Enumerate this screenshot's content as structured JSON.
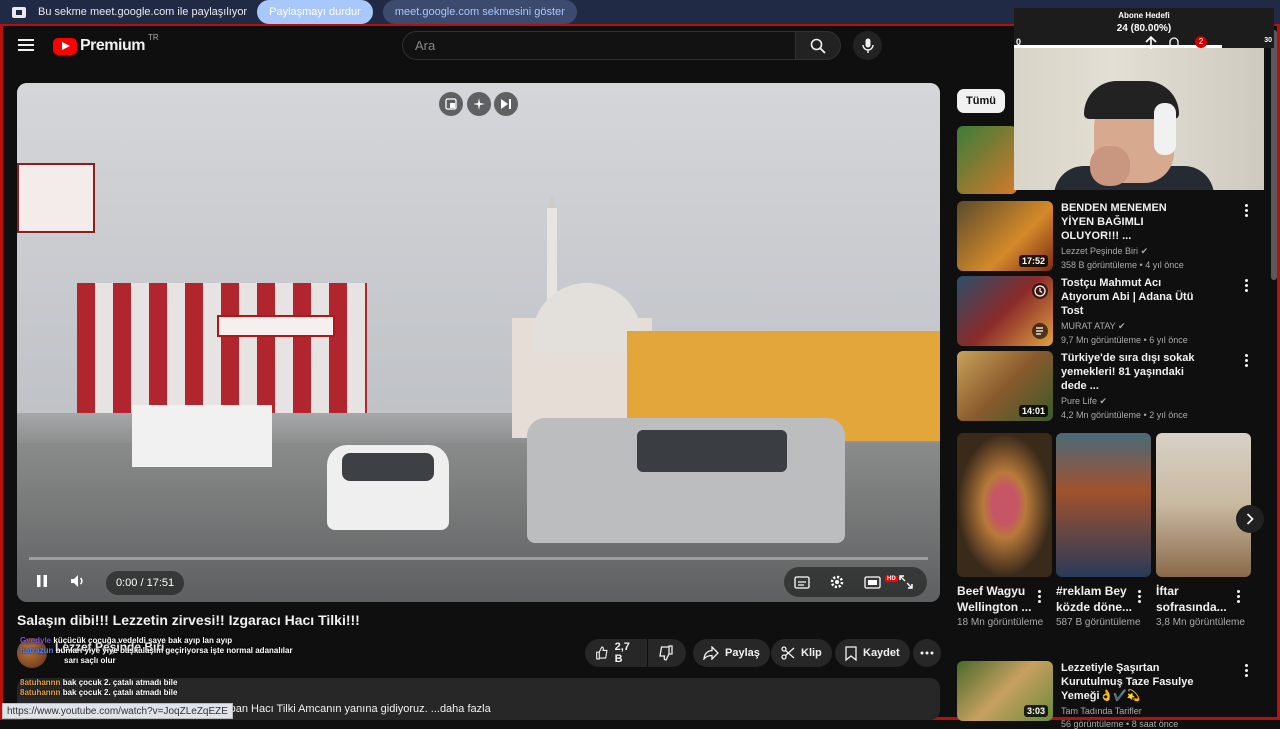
{
  "share_bar": {
    "message": "Bu sekme meet.google.com ile paylaşılıyor",
    "stop_label": "Paylaşmayı durdur",
    "show_label": "meet.google.com sekmesini göster"
  },
  "header": {
    "logo_text": "Premium",
    "region": "TR",
    "search_placeholder": "Ara"
  },
  "player": {
    "time": "0:00 / 17:51",
    "progress_fraction": 0,
    "hd_badge": "HD"
  },
  "video": {
    "title": "Salaşın dibi!!! Lezzetin zirvesi!! Izgaracı Hacı Tilki!!!",
    "channel": "Lezzet Peşinde Biri",
    "like_count": "2,7 B",
    "share_label": "Paylaş",
    "clip_label": "Klip",
    "save_label": "Kaydet",
    "description": "vapan Hacı Tilki Amcanın yanına gidiyoruz. ...daha fazla"
  },
  "chat_overlay": [
    {
      "user": "Gyedyle",
      "text": "küçücük çocuğa vedeldi saye bak ayıp lan ayıp"
    },
    {
      "user": "hatrazun",
      "text": "bunları yiye yiye başkalaşım geçiriyorsa işte normal adanalılar"
    },
    {
      "user": "",
      "text": "sarı saçlı olur"
    },
    {
      "user": "8atuhannn",
      "text": "bak çocuk 2. çatalı atmadı bile"
    },
    {
      "user": "8atuhannn",
      "text": "bak çocuk 2. çatalı atmadı bile"
    }
  ],
  "url_status": "https://www.youtube.com/watch?v=JoqZLeZqEZE",
  "sidebar": {
    "chip_all": "Tümü",
    "recommendations": [
      {
        "title": "BENDEN MENEMEN YİYEN BAĞIMLI OLUYOR!!! ...",
        "channel": "Lezzet Peşinde Biri",
        "meta": "358 B görüntüleme • 4 yıl önce",
        "duration": "17:52",
        "verified": true
      },
      {
        "title": "Tostçu Mahmut Acı Atıyorum Abi | Adana Ütü Tost",
        "channel": "MURAT ATAY",
        "meta": "9,7 Mn görüntüleme • 6 yıl önce",
        "duration": "",
        "verified": true
      },
      {
        "title": "Türkiye'de sıra dışı sokak yemekleri! 81 yaşındaki dede ...",
        "channel": "Pure Life",
        "meta": "4,2 Mn görüntüleme • 2 yıl önce",
        "duration": "14:01",
        "verified": true
      }
    ],
    "shorts": [
      {
        "title": "Beef Wagyu Wellington ...",
        "views": "18 Mn görüntüleme"
      },
      {
        "title": "#reklam Bey közde döne...",
        "views": "587 B görüntüleme"
      },
      {
        "title": "İftar sofrasında...",
        "views": "3,8 Mn görüntüleme"
      }
    ],
    "bottom_rec": {
      "title": "Lezzetiyle Şaşırtan Kurutulmuş Taze Fasulye Yemeği👌✔️💫",
      "channel": "Tam Tadında Tarifler",
      "meta": "56 görüntüleme • 8 saat önce",
      "duration": "3:03"
    }
  },
  "stream_overlay": {
    "goal_title": "Abone Hedefi",
    "goal_value": "24 (80.00%)",
    "goal_fraction": 0.8,
    "goal_min": "0",
    "goal_max": "30",
    "notification_count": "2"
  },
  "colors": {
    "accent_red": "#ff0000",
    "background": "#0f0f0f",
    "frame_border": "#b80f0f"
  }
}
